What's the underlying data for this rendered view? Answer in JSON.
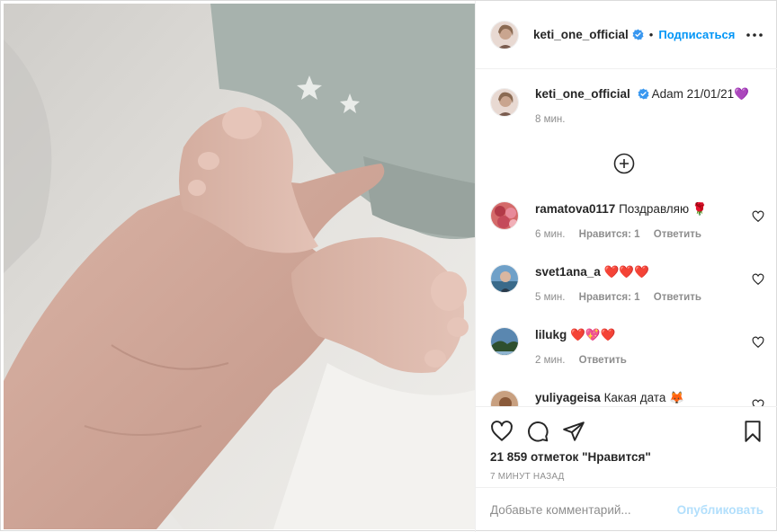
{
  "post": {
    "author": "keti_one_official",
    "follow_label": "Подписаться",
    "dot": "•",
    "caption_text": "Adam 21/01/21💜",
    "caption_time": "8 мин.",
    "photo_alt": "photo"
  },
  "comments": [
    {
      "user": "ramatova0117",
      "text": "Поздравляю 🌹",
      "time": "6 мин.",
      "likes": "Нравится: 1",
      "reply": "Ответить"
    },
    {
      "user": "svet1ana_a",
      "text": "❤️❤️❤️",
      "time": "5 мин.",
      "likes": "Нравится: 1",
      "reply": "Ответить"
    },
    {
      "user": "lilukg",
      "text": "❤️💖❤️",
      "time": "2 мин.",
      "likes": "",
      "reply": "Ответить"
    },
    {
      "user": "yuliyageisa",
      "text": "Какая дата 🦊",
      "time": "",
      "likes": "",
      "reply": ""
    }
  ],
  "stats": {
    "likes": "21 859 отметок \"Нравится\"",
    "timestamp": "7 минут назад"
  },
  "composer": {
    "placeholder": "Добавьте комментарий...",
    "publish": "Опубликовать"
  },
  "icons": {
    "verified": "verified-badge-icon",
    "more": "more-options-icon",
    "load_more": "plus-circle-icon",
    "like": "heart-icon",
    "comment": "comment-icon",
    "share": "share-icon",
    "save": "bookmark-icon"
  },
  "colors": {
    "accent": "#0095f6",
    "verified": "#3897f0",
    "muted": "#8e8e8e",
    "border": "#dbdbdb"
  }
}
